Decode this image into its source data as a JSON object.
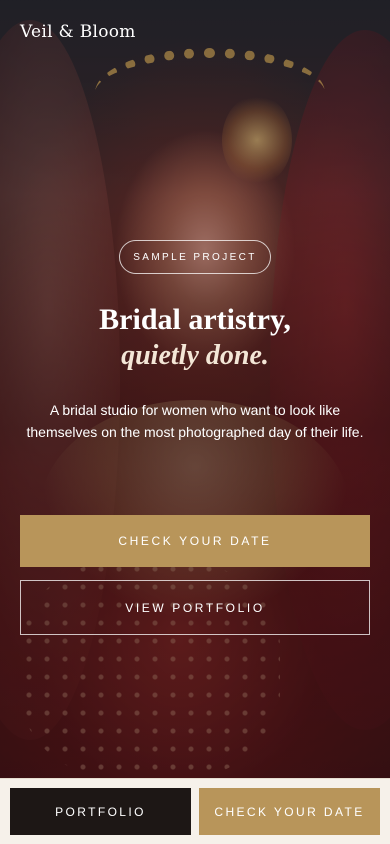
{
  "brand": {
    "name": "Veil & Bloom"
  },
  "hero": {
    "image_alt_icon": "bride-photo",
    "badge": "SAMPLE PROJECT",
    "headline_line1": "Bridal artistry,",
    "headline_line2": "quietly done.",
    "subtext": "A bridal studio for women who want to look like themselves on the most photographed day of their life.",
    "primary_cta": "CHECK YOUR DATE",
    "secondary_cta": "VIEW PORTFOLIO"
  },
  "bottom_bar": {
    "left_button": "PORTFOLIO",
    "right_button": "CHECK YOUR DATE"
  },
  "colors": {
    "accent_gold": "#b8955a",
    "dark": "#1d1715",
    "bar_background": "#f6f1ea"
  }
}
